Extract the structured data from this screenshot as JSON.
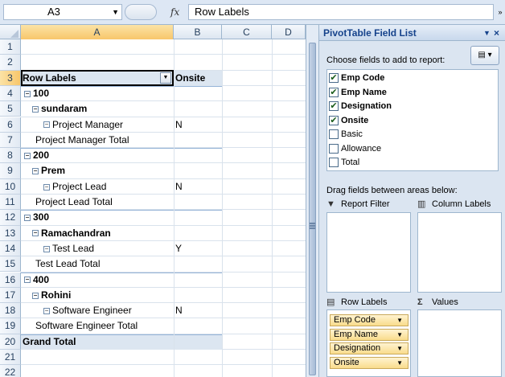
{
  "formula_bar": {
    "name_box": "A3",
    "fx": "fx",
    "formula": "Row Labels"
  },
  "columns": [
    "A",
    "B",
    "C",
    "D"
  ],
  "rows": [
    {
      "num": "1",
      "a": "",
      "b": ""
    },
    {
      "num": "2",
      "a": "",
      "b": ""
    },
    {
      "num": "3",
      "a": "Row Labels",
      "b": "Onsite"
    },
    {
      "num": "4",
      "a": "100",
      "b": ""
    },
    {
      "num": "5",
      "a": "sundaram",
      "b": ""
    },
    {
      "num": "6",
      "a": "Project Manager",
      "b": "N"
    },
    {
      "num": "7",
      "a": "Project Manager Total",
      "b": ""
    },
    {
      "num": "8",
      "a": "200",
      "b": ""
    },
    {
      "num": "9",
      "a": "Prem",
      "b": ""
    },
    {
      "num": "10",
      "a": "Project Lead",
      "b": "N"
    },
    {
      "num": "11",
      "a": "Project Lead Total",
      "b": ""
    },
    {
      "num": "12",
      "a": "300",
      "b": ""
    },
    {
      "num": "13",
      "a": "Ramachandran",
      "b": ""
    },
    {
      "num": "14",
      "a": "Test Lead",
      "b": "Y"
    },
    {
      "num": "15",
      "a": "Test Lead Total",
      "b": ""
    },
    {
      "num": "16",
      "a": "400",
      "b": ""
    },
    {
      "num": "17",
      "a": "Rohini",
      "b": ""
    },
    {
      "num": "18",
      "a": "Software Engineer",
      "b": "N"
    },
    {
      "num": "19",
      "a": "Software Engineer Total",
      "b": ""
    },
    {
      "num": "20",
      "a": "Grand Total",
      "b": ""
    },
    {
      "num": "21",
      "a": "",
      "b": ""
    },
    {
      "num": "22",
      "a": "",
      "b": ""
    }
  ],
  "pivot_pane": {
    "title": "PivotTable Field List",
    "choose_label": "Choose fields to add to report:",
    "fields": [
      {
        "name": "Emp Code",
        "checked": true
      },
      {
        "name": "Emp Name",
        "checked": true
      },
      {
        "name": "Designation",
        "checked": true
      },
      {
        "name": "Onsite",
        "checked": true
      },
      {
        "name": "Basic",
        "checked": false
      },
      {
        "name": "Allowance",
        "checked": false
      },
      {
        "name": "Total",
        "checked": false
      }
    ],
    "drag_label": "Drag fields between areas below:",
    "report_filter": "Report Filter",
    "column_labels": "Column Labels",
    "row_labels": "Row Labels",
    "values": "Values",
    "row_fields": [
      "Emp Code",
      "Emp Name",
      "Designation",
      "Onsite"
    ]
  }
}
